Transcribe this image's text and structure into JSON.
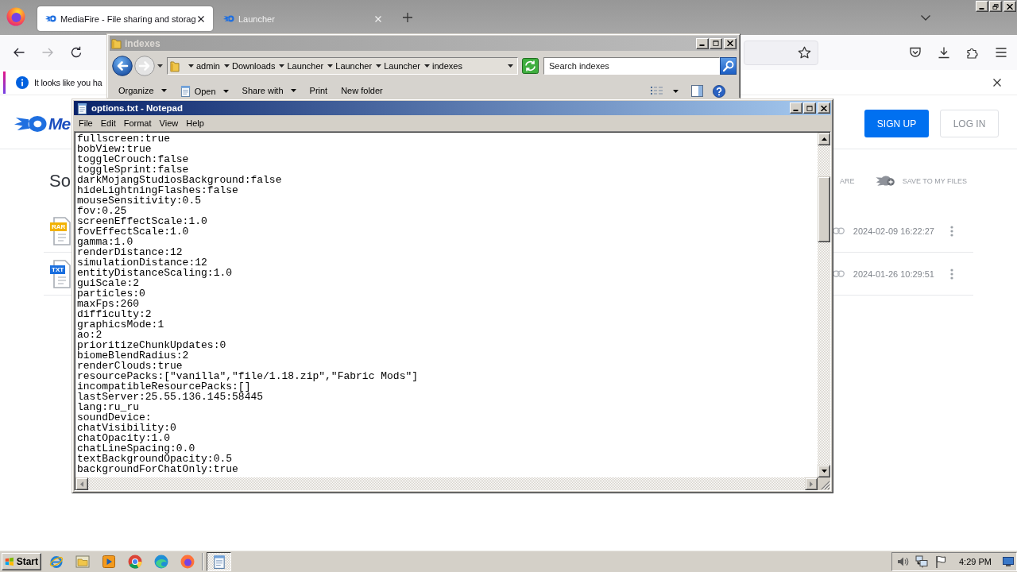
{
  "browser": {
    "tabs": [
      {
        "title": "MediaFire - File sharing and storag",
        "selected": true
      },
      {
        "title": "Launcher",
        "selected": false
      }
    ],
    "nav_buttons": [
      {
        "kind": "back",
        "disabled": false
      },
      {
        "kind": "forward",
        "disabled": true
      },
      {
        "kind": "reload",
        "disabled": false
      }
    ],
    "notification": {
      "text": "It looks like you ha"
    }
  },
  "page": {
    "logo_text": "Me",
    "buttons": [
      {
        "label": "SIGN UP",
        "kind": "primary"
      },
      {
        "label": "LOG IN",
        "kind": "outline"
      }
    ],
    "heading": "So",
    "actions": [
      {
        "label": "ARE",
        "kind": "plain"
      },
      {
        "label": "SAVE TO MY FILES",
        "kind": "save"
      }
    ],
    "files": [
      {
        "tag": "RAR",
        "color": "#f2b200",
        "date": "2024-02-09 16:22:27"
      },
      {
        "tag": "TXT",
        "color": "#1a6fdf",
        "date": "2024-01-26 10:29:51"
      }
    ]
  },
  "explorer": {
    "title": "indexes",
    "active": false,
    "breadcrumb": [
      "admin",
      "Downloads",
      "Launcher",
      "Launcher",
      "Launcher",
      "indexes"
    ],
    "search": {
      "placeholder": "Search indexes"
    },
    "toolbar": [
      {
        "label": "Organize",
        "kind": "menu"
      },
      {
        "label": "Open",
        "kind": "open"
      },
      {
        "label": "Share with",
        "kind": "menu"
      },
      {
        "label": "Print",
        "kind": "plain"
      },
      {
        "label": "New folder",
        "kind": "plain"
      }
    ]
  },
  "notepad": {
    "title": "options.txt - Notepad",
    "active": true,
    "menu": [
      "File",
      "Edit",
      "Format",
      "View",
      "Help"
    ],
    "lines": [
      "fullscreen:true",
      "bobView:true",
      "toggleCrouch:false",
      "toggleSprint:false",
      "darkMojangStudiosBackground:false",
      "hideLightningFlashes:false",
      "mouseSensitivity:0.5",
      "fov:0.25",
      "screenEffectScale:1.0",
      "fovEffectScale:1.0",
      "gamma:1.0",
      "renderDistance:12",
      "simulationDistance:12",
      "entityDistanceScaling:1.0",
      "guiScale:2",
      "particles:0",
      "maxFps:260",
      "difficulty:2",
      "graphicsMode:1",
      "ao:2",
      "prioritizeChunkUpdates:0",
      "biomeBlendRadius:2",
      "renderClouds:true",
      "resourcePacks:[\"vanilla\",\"file/1.18.zip\",\"Fabric Mods\"]",
      "incompatibleResourcePacks:[]",
      "lastServer:25.55.136.145:58445",
      "lang:ru_ru",
      "soundDevice:",
      "chatVisibility:0",
      "chatOpacity:1.0",
      "chatLineSpacing:0.0",
      "textBackgroundOpacity:0.5",
      "backgroundForChatOnly:true"
    ]
  },
  "taskbar": {
    "start": "Start",
    "items": [
      {
        "kind": "ie",
        "selected": false
      },
      {
        "kind": "explorer",
        "selected": false
      },
      {
        "kind": "media",
        "selected": false
      },
      {
        "kind": "chrome",
        "selected": false
      },
      {
        "kind": "edge",
        "selected": false
      },
      {
        "kind": "firefox",
        "selected": false
      },
      {
        "kind": "notepad",
        "selected": true
      }
    ],
    "clock": "4:29 PM"
  }
}
